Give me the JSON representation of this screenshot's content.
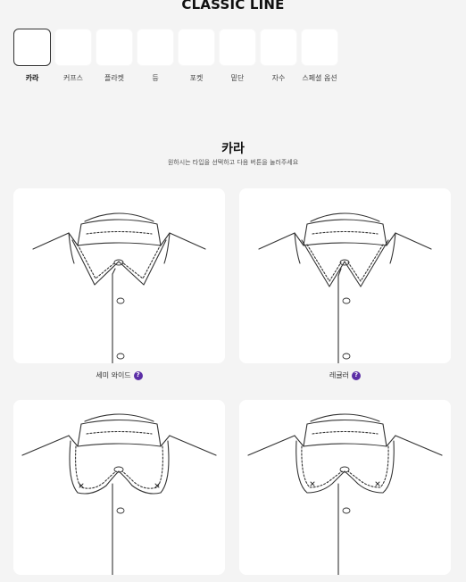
{
  "header": {
    "title": "CLASSIC LINE"
  },
  "steps": [
    {
      "label": "카라",
      "active": true
    },
    {
      "label": "커프스",
      "active": false
    },
    {
      "label": "플라켓",
      "active": false
    },
    {
      "label": "등",
      "active": false
    },
    {
      "label": "포켓",
      "active": false
    },
    {
      "label": "밑단",
      "active": false
    },
    {
      "label": "자수",
      "active": false
    },
    {
      "label": "스페셜 옵션",
      "active": false
    }
  ],
  "section": {
    "title": "카라",
    "subtitle": "원하시는 타입을 선택하고 다음 버튼을 눌러주세요"
  },
  "options": [
    {
      "label": "세미 와이드",
      "help": "?",
      "icon": "semi-wide-collar-icon"
    },
    {
      "label": "레귤러",
      "help": "?",
      "icon": "regular-collar-icon"
    },
    {
      "label": "",
      "help": "",
      "icon": "round-button-down-collar-icon"
    },
    {
      "label": "",
      "help": "",
      "icon": "round-button-down-collar-icon"
    }
  ],
  "colors": {
    "accent": "#5b2ea6",
    "background": "#f4f4f4",
    "card": "#ffffff"
  }
}
